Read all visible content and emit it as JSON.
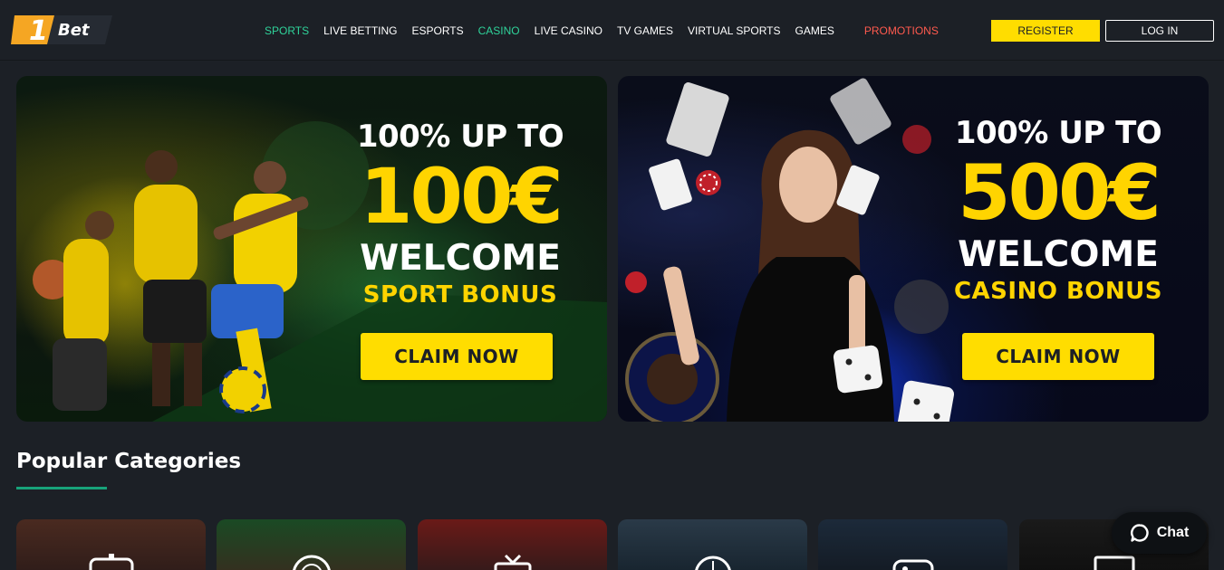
{
  "brand": {
    "logo_number": "1",
    "logo_text": "Bet",
    "logo_color": "#f5a623"
  },
  "nav": {
    "items": [
      {
        "label": "SPORTS",
        "accent": true
      },
      {
        "label": "LIVE BETTING",
        "accent": false
      },
      {
        "label": "ESPORTS",
        "accent": false
      },
      {
        "label": "CASINO",
        "accent": true
      },
      {
        "label": "LIVE CASINO",
        "accent": false
      },
      {
        "label": "TV GAMES",
        "accent": false
      },
      {
        "label": "VIRTUAL SPORTS",
        "accent": false
      },
      {
        "label": "GAMES",
        "accent": false
      }
    ],
    "promotions_label": "PROMOTIONS"
  },
  "auth": {
    "register_label": "REGISTER",
    "login_label": "LOG IN"
  },
  "banners": [
    {
      "line1": "100% UP TO",
      "amount": "100€",
      "welcome": "WELCOME",
      "bonus": "SPORT BONUS",
      "cta": "CLAIM NOW"
    },
    {
      "line1": "100% UP TO",
      "amount": "500€",
      "welcome": "WELCOME",
      "bonus": "CASINO BONUS",
      "cta": "CLAIM NOW"
    }
  ],
  "popular": {
    "title": "Popular Categories",
    "cards": [
      {
        "icon": "gamepad-icon"
      },
      {
        "icon": "roulette-wheel-icon"
      },
      {
        "icon": "tv-icon"
      },
      {
        "icon": "soccer-ball-icon"
      },
      {
        "icon": "joystick-icon"
      },
      {
        "icon": "monitor-icon"
      }
    ]
  },
  "chat": {
    "label": "Chat"
  },
  "colors": {
    "background": "#1c2026",
    "accent_green": "#2fd39a",
    "promo_red": "#ff5a4e",
    "yellow": "#ffdd00"
  }
}
